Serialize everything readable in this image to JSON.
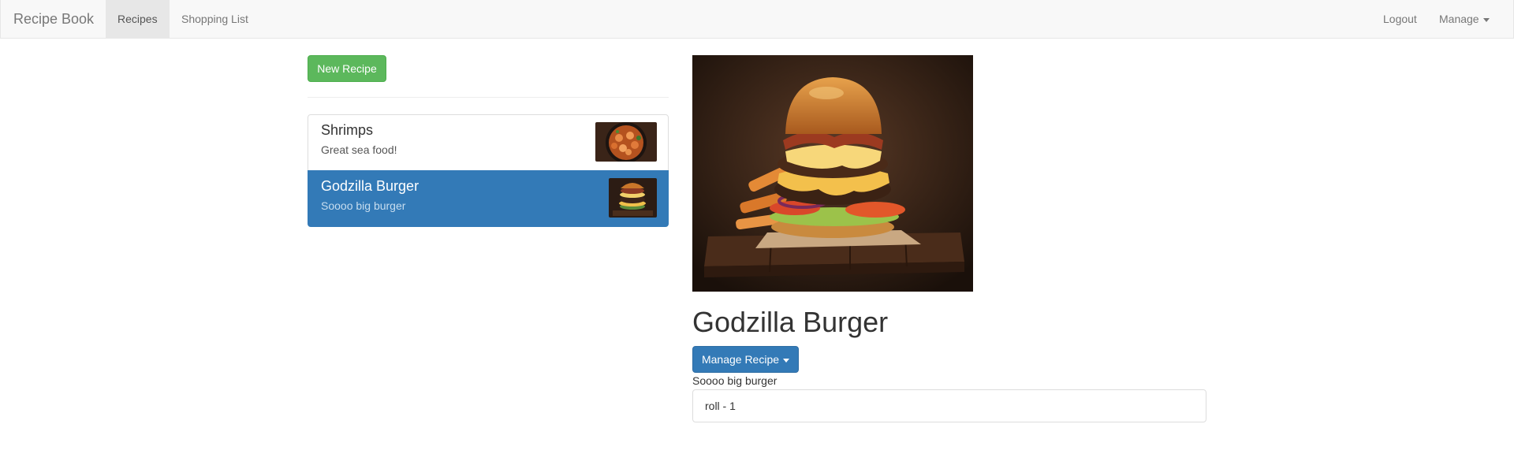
{
  "navbar": {
    "brand": "Recipe Book",
    "links": {
      "recipes": "Recipes",
      "shopping_list": "Shopping List"
    },
    "right": {
      "logout": "Logout",
      "manage": "Manage"
    }
  },
  "sidebar": {
    "new_recipe_label": "New Recipe",
    "recipes": [
      {
        "name": "Shrimps",
        "description": "Great sea food!",
        "image": "shrimp-dish-thumbnail",
        "selected": false
      },
      {
        "name": "Godzilla Burger",
        "description": "Soooo big burger",
        "image": "burger-thumbnail",
        "selected": true
      }
    ]
  },
  "detail": {
    "image": "burger-photo",
    "name": "Godzilla Burger",
    "manage_label": "Manage Recipe",
    "description": "Soooo big burger",
    "ingredients": [
      {
        "text": "roll - 1"
      }
    ]
  },
  "colors": {
    "primary": "#337ab7",
    "success": "#5cb85c",
    "navbar_bg": "#f8f8f8"
  }
}
